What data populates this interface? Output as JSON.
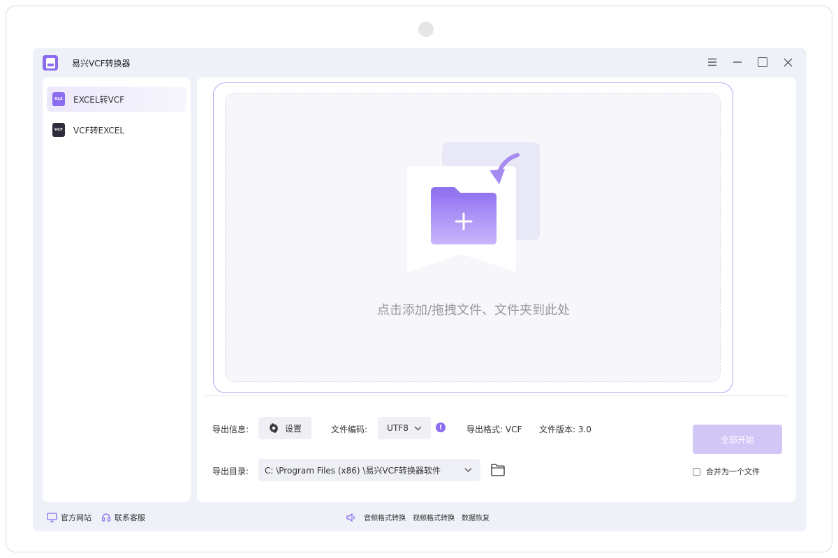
{
  "window": {
    "title": "易兴VCF转换器",
    "controls": [
      "menu-icon",
      "minimize-icon",
      "maximize-icon",
      "close-icon"
    ]
  },
  "sidebar": {
    "items": [
      {
        "label": "EXCEL转VCF",
        "icon_text": "XLS",
        "active": true
      },
      {
        "label": "VCF转EXCEL",
        "icon_text": "VCF",
        "active": false
      }
    ]
  },
  "dropzone": {
    "hint": "点击添加/拖拽文件、文件夹到此处"
  },
  "export": {
    "info_label": "导出信息:",
    "settings_label": "设置",
    "encoding_label": "文件编码:",
    "encoding_value": "UTF8",
    "format_text": "导出格式: VCF",
    "version_text": "文件版本: 3.0",
    "dir_label": "导出目录:",
    "dir_value": "C: \\Program  Files (x86) \\易兴VCF转换器软件"
  },
  "actions": {
    "start_label": "全部开始",
    "merge_label": "合并为一个文件",
    "merge_checked": false
  },
  "footer": {
    "website": "官方网站",
    "support": "联系客服",
    "links": [
      "音频格式转换",
      "视频格式转换",
      "数据恢复"
    ]
  },
  "colors": {
    "accent": "#8b6cf0",
    "accent_light": "#d2c6f7",
    "app_bg": "#eef1f8"
  }
}
